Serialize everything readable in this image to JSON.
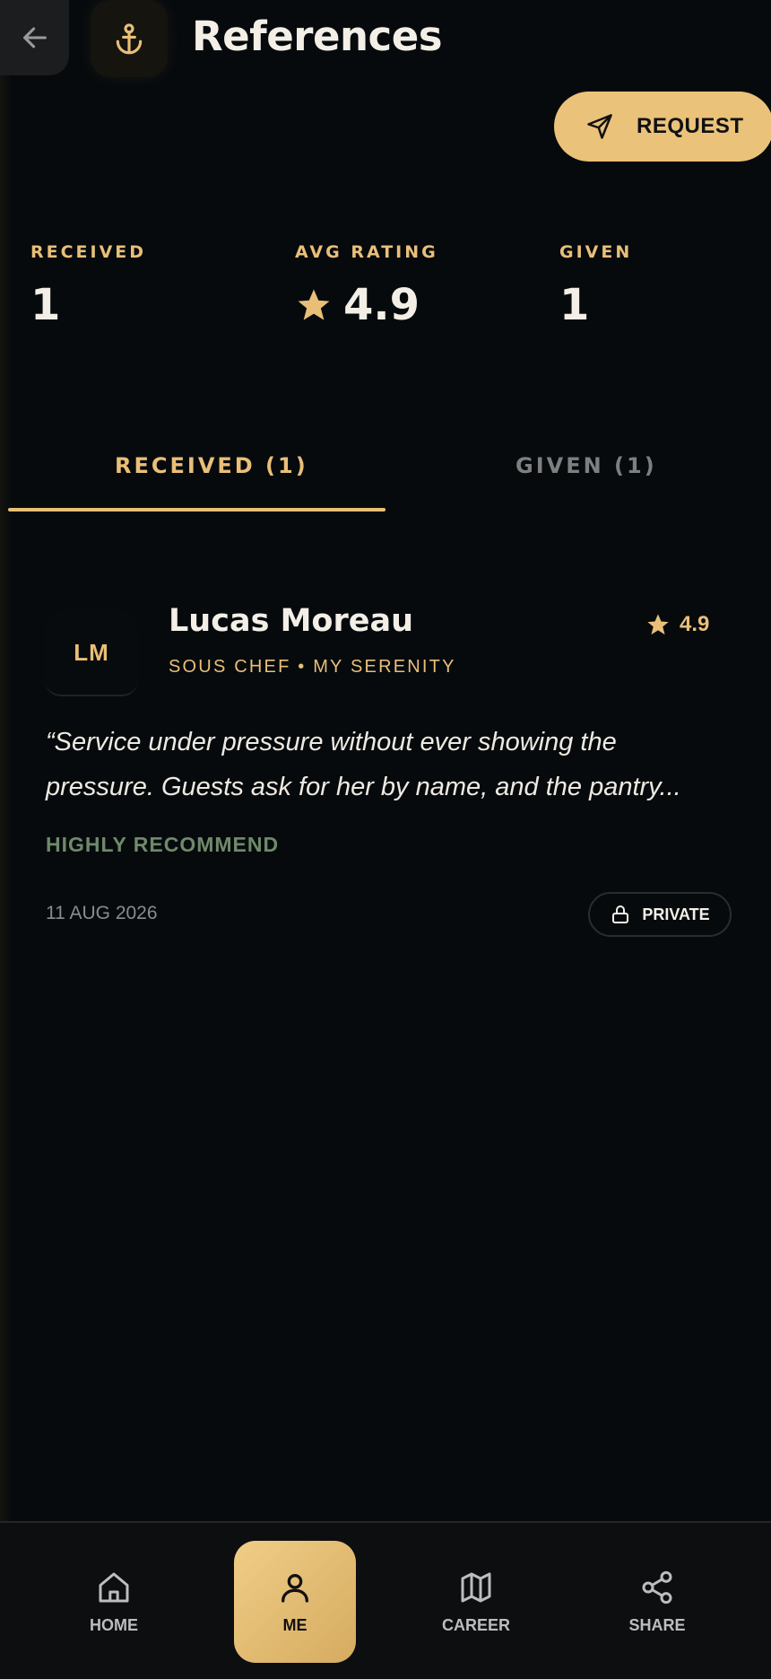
{
  "header": {
    "title": "References",
    "request_label": "REQUEST"
  },
  "stats": {
    "received_label": "RECEIVED",
    "received_value": "1",
    "avg_label": "AVG RATING",
    "avg_value": "4.9",
    "given_label": "GIVEN",
    "given_value": "1"
  },
  "tabs": {
    "received": "RECEIVED (1)",
    "given": "GIVEN (1)"
  },
  "reference": {
    "initials": "LM",
    "name": "Lucas Moreau",
    "role": "SOUS CHEF • MY SERENITY",
    "rating": "4.9",
    "quote_line1": "“Service under pressure without ever showing the",
    "quote_line2": "pressure. Guests ask for her by name, and the pantry...",
    "recommendation": "HIGHLY RECOMMEND",
    "date": "11 AUG 2026",
    "visibility": "PRIVATE"
  },
  "nav": {
    "home": "HOME",
    "me": "ME",
    "career": "CAREER",
    "share": "SHARE"
  },
  "colors": {
    "accent": "#e9bf78",
    "background": "#060a0d",
    "recommend": "#6f8a6a"
  }
}
